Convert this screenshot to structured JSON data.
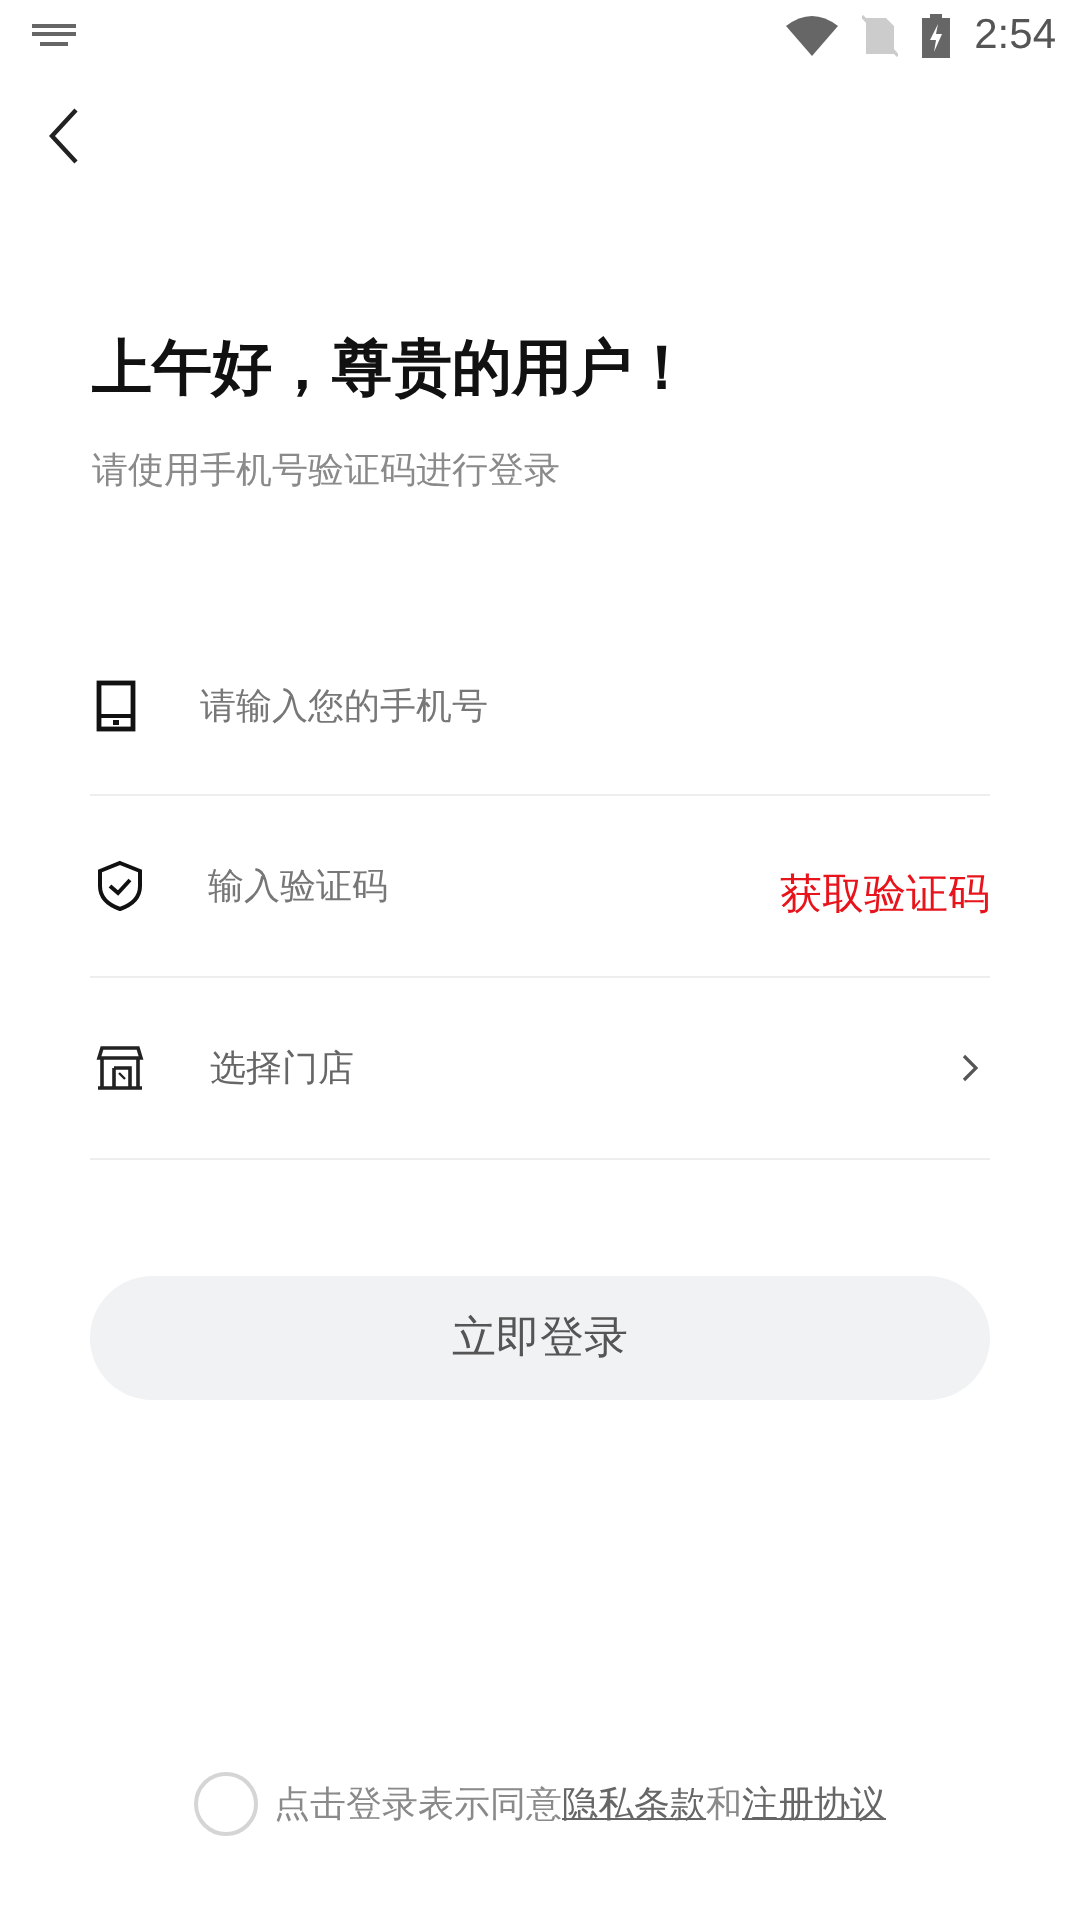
{
  "status_bar": {
    "time": "2:54"
  },
  "greeting": "上午好，尊贵的用户！",
  "subtitle": "请使用手机号验证码进行登录",
  "fields": [
    {
      "kind": "phone",
      "placeholder": "请输入您的手机号"
    },
    {
      "kind": "code",
      "placeholder": "输入验证码",
      "action": "获取验证码"
    },
    {
      "kind": "store",
      "label": "选择门店"
    }
  ],
  "login_button": "立即登录",
  "agreement": {
    "checked": false,
    "text": "点击登录表示同意",
    "privacy_link": "隐私条款",
    "joiner": "和",
    "terms_link": "注册协议"
  }
}
